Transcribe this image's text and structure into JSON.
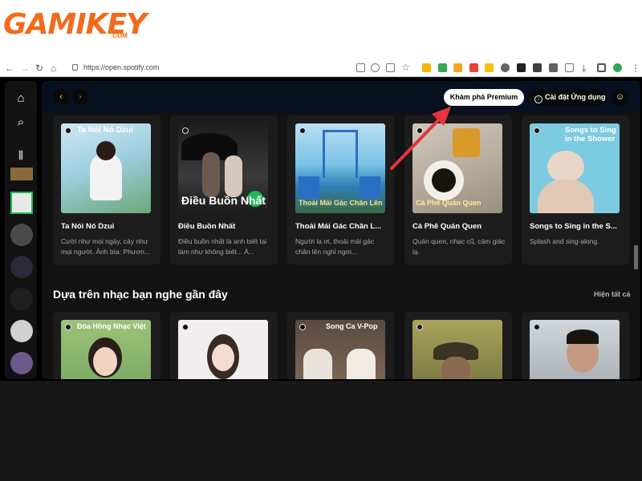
{
  "watermark": {
    "brand": "GAMIKEY",
    "domain": ".COM"
  },
  "browser": {
    "url": "https://open.spotify.com"
  },
  "topbar": {
    "premium_label": "Khám phá Premium",
    "install_label": "Cài đặt Ứng dụng"
  },
  "cards_row1": [
    {
      "cover_title": "Ta Nói Nó Dzui",
      "name": "Ta Nói Nó Dzui",
      "desc": "Cười như mọi ngày, cày như mọi người. Ảnh bìa: Phươn..."
    },
    {
      "cover_title": "",
      "cover_text": "Điều Buồn Nhất",
      "name": "Điều Buồn Nhất",
      "desc": "Điều buồn nhất là anh biết lại làm như không biết... À..."
    },
    {
      "cover_title": "",
      "cover_text": "Thoải Mái Gác Chân Lên",
      "name": "Thoải Mái Gác Chân L...",
      "desc": "Người lạ ơi, thoải mái gác chân lên nghỉ ngơi..."
    },
    {
      "cover_title": "",
      "cover_text": "Cà Phê Quán Quen",
      "name": "Cà Phê Quán Quen",
      "desc": "Quán quen, nhạc cũ, cảm giác lạ."
    },
    {
      "cover_title": "Songs to Sing in the Shower",
      "name": "Songs to Sing in the S...",
      "desc": "Splash and sing-along."
    }
  ],
  "section2": {
    "title": "Dựa trên nhạc bạn nghe gần đây",
    "show_all": "Hiện tất cả",
    "cards": [
      {
        "cover_title": "Đóa Hồng Nhạc Việt"
      },
      {
        "cover_title": ""
      },
      {
        "cover_title": "Song Ca V-Pop"
      },
      {
        "cover_title": ""
      },
      {
        "cover_title": ""
      }
    ]
  },
  "colors": {
    "brand_orange": "#f26b1d",
    "spotify_green": "#1db954",
    "arrow_red": "#e8323c"
  }
}
